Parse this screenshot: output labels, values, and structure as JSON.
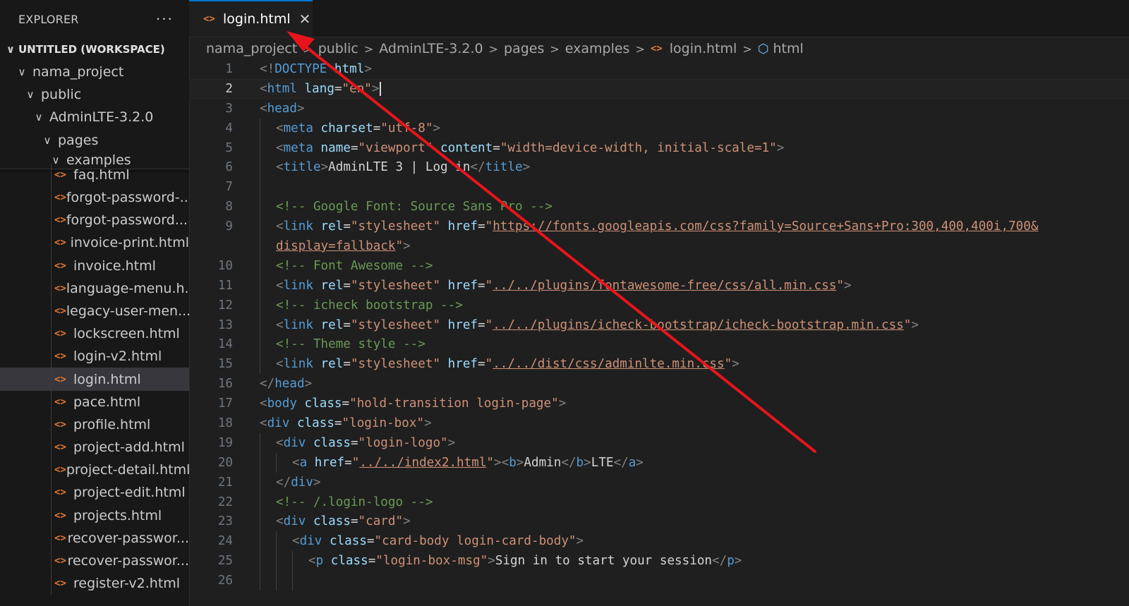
{
  "sidebar": {
    "title": "EXPLORER",
    "more": "···",
    "workspace": "UNTITLED (WORKSPACE)",
    "folders": [
      "nama_project",
      "public",
      "AdminLTE-3.2.0",
      "pages",
      "examples"
    ],
    "files": [
      "faq.html",
      "forgot-password-...",
      "forgot-password....",
      "invoice-print.html",
      "invoice.html",
      "language-menu.h...",
      "legacy-user-men...",
      "lockscreen.html",
      "login-v2.html",
      "login.html",
      "pace.html",
      "profile.html",
      "project-add.html",
      "project-detail.html",
      "project-edit.html",
      "projects.html",
      "recover-passwor...",
      "recover-passwor...",
      "register-v2.html"
    ],
    "selected_index": 9
  },
  "tab": {
    "label": "login.html",
    "close": "✕"
  },
  "breadcrumb": [
    "nama_project",
    "public",
    "AdminLTE-3.2.0",
    "pages",
    "examples",
    "login.html",
    "html"
  ],
  "line_numbers": [
    "1",
    "2",
    "3",
    "4",
    "5",
    "6",
    "7",
    "8",
    "9",
    "",
    "10",
    "11",
    "12",
    "13",
    "14",
    "15",
    "16",
    "17",
    "18",
    "19",
    "20",
    "21",
    "22",
    "23",
    "24",
    "25",
    "26"
  ],
  "code": {
    "l1": [
      "<!",
      "DOCTYPE",
      " html",
      ">"
    ],
    "l2": [
      "<",
      "html",
      " lang",
      "=",
      "\"en\"",
      ">"
    ],
    "l3": [
      "<",
      "head",
      ">"
    ],
    "l4": [
      "<",
      "meta",
      " charset",
      "=",
      "\"utf-8\"",
      ">"
    ],
    "l5": [
      "<",
      "meta",
      " name",
      "=",
      "\"viewport\"",
      " content",
      "=",
      "\"width=device-width, initial-scale=1\"",
      ">"
    ],
    "l6": [
      "<",
      "title",
      ">",
      "AdminLTE 3 | Log in",
      "</",
      "title",
      ">"
    ],
    "l8": "<!-- Google Font: Source Sans Pro -->",
    "l9": [
      "<",
      "link",
      " rel",
      "=",
      "\"stylesheet\"",
      " href",
      "=",
      "\"",
      "https://fonts.googleapis.com/css?family=Source+Sans+Pro:300,400,400i,700&"
    ],
    "l9b": [
      "display=fallback",
      "\"",
      ">"
    ],
    "l10": "<!-- Font Awesome -->",
    "l11": [
      "<",
      "link",
      " rel",
      "=",
      "\"stylesheet\"",
      " href",
      "=",
      "\"",
      "../../plugins/fontawesome-free/css/all.min.css",
      "\"",
      ">"
    ],
    "l12": "<!-- icheck bootstrap -->",
    "l13": [
      "<",
      "link",
      " rel",
      "=",
      "\"stylesheet\"",
      " href",
      "=",
      "\"",
      "../../plugins/icheck-bootstrap/icheck-bootstrap.min.css",
      "\"",
      ">"
    ],
    "l14": "<!-- Theme style -->",
    "l15": [
      "<",
      "link",
      " rel",
      "=",
      "\"stylesheet\"",
      " href",
      "=",
      "\"",
      "../../dist/css/adminlte.min.css",
      "\"",
      ">"
    ],
    "l16": [
      "</",
      "head",
      ">"
    ],
    "l17": [
      "<",
      "body",
      " class",
      "=",
      "\"hold-transition login-page\"",
      ">"
    ],
    "l18": [
      "<",
      "div",
      " class",
      "=",
      "\"login-box\"",
      ">"
    ],
    "l19": [
      "<",
      "div",
      " class",
      "=",
      "\"login-logo\"",
      ">"
    ],
    "l20": [
      "<",
      "a",
      " href",
      "=",
      "\"",
      "../../index2.html",
      "\"",
      "><",
      "b",
      ">",
      "Admin",
      "</",
      "b",
      ">",
      "LTE",
      "</",
      "a",
      ">"
    ],
    "l21": [
      "</",
      "div",
      ">"
    ],
    "l22": "<!-- /.login-logo -->",
    "l23": [
      "<",
      "div",
      " class",
      "=",
      "\"card\"",
      ">"
    ],
    "l24": [
      "<",
      "div",
      " class",
      "=",
      "\"card-body login-card-body\"",
      ">"
    ],
    "l25": [
      "<",
      "p",
      " class",
      "=",
      "\"login-box-msg\"",
      ">",
      "Sign in to start your session",
      "</",
      "p",
      ">"
    ]
  },
  "colors": {
    "annotation_arrow": "#e8141b",
    "file_icon": "#e37933",
    "tab_accent": "#0078d4"
  }
}
